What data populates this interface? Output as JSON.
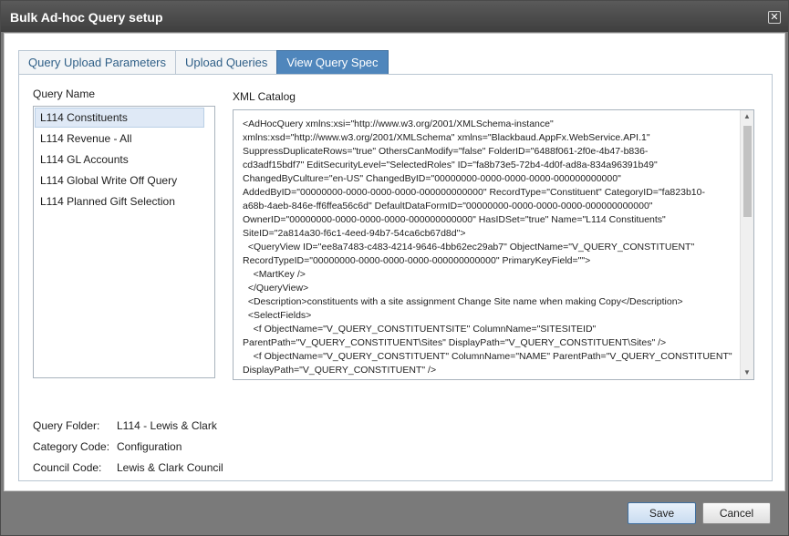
{
  "window": {
    "title": "Bulk Ad-hoc Query setup",
    "close_glyph": "✕"
  },
  "tabs": [
    {
      "label": "Query Upload Parameters",
      "active": false
    },
    {
      "label": "Upload Queries",
      "active": false
    },
    {
      "label": "View Query Spec",
      "active": true
    }
  ],
  "query_list": {
    "label": "Query Name",
    "items": [
      "L114 Constituents",
      "L114 Revenue - All",
      "L114 GL Accounts",
      "L114 Global Write Off Query",
      "L114 Planned Gift Selection"
    ],
    "selected_index": 0
  },
  "xml_catalog": {
    "label": "XML Catalog",
    "lines": [
      "<AdHocQuery xmlns:xsi=\"http://www.w3.org/2001/XMLSchema-instance\"",
      "xmlns:xsd=\"http://www.w3.org/2001/XMLSchema\" xmlns=\"Blackbaud.AppFx.WebService.API.1\"",
      "SuppressDuplicateRows=\"true\" OthersCanModify=\"false\" FolderID=\"6488f061-2f0e-4b47-b836-",
      "cd3adf15bdf7\" EditSecurityLevel=\"SelectedRoles\" ID=\"fa8b73e5-72b4-4d0f-ad8a-834a96391b49\"",
      "ChangedByCulture=\"en-US\" ChangedByID=\"00000000-0000-0000-0000-000000000000\"",
      "AddedByID=\"00000000-0000-0000-0000-000000000000\" RecordType=\"Constituent\" CategoryID=\"fa823b10-",
      "a68b-4aeb-846e-ff6ffea56c6d\" DefaultDataFormID=\"00000000-0000-0000-0000-000000000000\"",
      "OwnerID=\"00000000-0000-0000-0000-000000000000\" HasIDSet=\"true\" Name=\"L114 Constituents\"",
      "SiteID=\"2a814a30-f6c1-4eed-94b7-54ca6cb67d8d\">",
      "  <QueryView ID=\"ee8a7483-c483-4214-9646-4bb62ec29ab7\" ObjectName=\"V_QUERY_CONSTITUENT\"",
      "RecordTypeID=\"00000000-0000-0000-0000-000000000000\" PrimaryKeyField=\"\">",
      "    <MartKey />",
      "  </QueryView>",
      "  <Description>constituents with a site assignment Change Site name when making Copy</Description>",
      "  <SelectFields>",
      "    <f ObjectName=\"V_QUERY_CONSTITUENTSITE\" ColumnName=\"SITESITEID\"",
      "ParentPath=\"V_QUERY_CONSTITUENT\\Sites\" DisplayPath=\"V_QUERY_CONSTITUENT\\Sites\" />",
      "    <f ObjectName=\"V_QUERY_CONSTITUENT\" ColumnName=\"NAME\" ParentPath=\"V_QUERY_CONSTITUENT\"",
      "DisplayPath=\"V_QUERY_CONSTITUENT\" />"
    ]
  },
  "details": [
    {
      "key": "Query Folder:",
      "value": "L114 - Lewis & Clark"
    },
    {
      "key": "Category Code:",
      "value": "Configuration"
    },
    {
      "key": "Council Code:",
      "value": "Lewis & Clark Council"
    }
  ],
  "buttons": {
    "save": "Save",
    "cancel": "Cancel"
  }
}
